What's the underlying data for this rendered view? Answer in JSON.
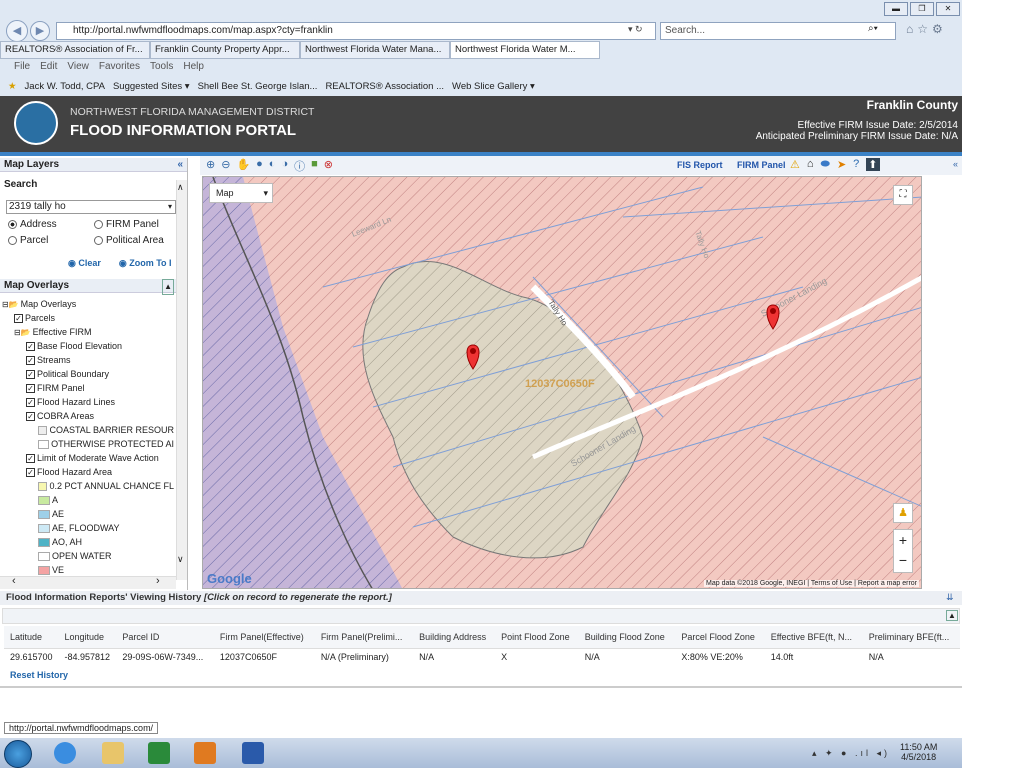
{
  "browser": {
    "url": "http://portal.nwfwmdfloodmaps.com/map.aspx?cty=franklin",
    "search_placeholder": "Search...",
    "tabs": [
      {
        "label": "REALTORS® Association of Fr...",
        "active": false
      },
      {
        "label": "Franklin County Property Appr...",
        "active": false
      },
      {
        "label": "Northwest Florida Water Mana...",
        "active": false
      },
      {
        "label": "Northwest Florida Water M...",
        "active": true
      }
    ],
    "menu": [
      "File",
      "Edit",
      "View",
      "Favorites",
      "Tools",
      "Help"
    ],
    "favorites": [
      "Jack W. Todd, CPA",
      "Suggested Sites ▾",
      "Shell Bee  St. George Islan...",
      "REALTORS® Association ...",
      "Web Slice Gallery ▾"
    ]
  },
  "header": {
    "org": "NORTHWEST FLORIDA MANAGEMENT DISTRICT",
    "title": "FLOOD INFORMATION PORTAL",
    "county": "Franklin County",
    "effective": "Effective FIRM Issue Date: 2/5/2014",
    "anticipated": "Anticipated Preliminary FIRM Issue Date: N/A"
  },
  "sidebar": {
    "map_layers": "Map Layers",
    "search": "Search",
    "search_value": "2319 tally ho",
    "radios": [
      {
        "label": "Address",
        "selected": true
      },
      {
        "label": "FIRM Panel",
        "selected": false
      },
      {
        "label": "Parcel",
        "selected": false
      },
      {
        "label": "Political Area",
        "selected": false
      }
    ],
    "clear": "Clear",
    "zoom": "Zoom To I",
    "map_overlays": "Map Overlays",
    "tree": [
      {
        "label": "Map Overlays",
        "indent": 0,
        "kind": "folder"
      },
      {
        "label": "Parcels",
        "indent": 1,
        "kind": "check"
      },
      {
        "label": "Effective FIRM",
        "indent": 1,
        "kind": "folder"
      },
      {
        "label": "Base Flood Elevation",
        "indent": 2,
        "kind": "check"
      },
      {
        "label": "Streams",
        "indent": 2,
        "kind": "check"
      },
      {
        "label": "Political Boundary",
        "indent": 2,
        "kind": "check"
      },
      {
        "label": "FIRM Panel",
        "indent": 2,
        "kind": "check"
      },
      {
        "label": "Flood Hazard Lines",
        "indent": 2,
        "kind": "check"
      },
      {
        "label": "COBRA Areas",
        "indent": 2,
        "kind": "check"
      },
      {
        "label": "COASTAL BARRIER RESOUR",
        "indent": 3,
        "kind": "legend"
      },
      {
        "label": "OTHERWISE PROTECTED AI",
        "indent": 3,
        "kind": "legend"
      },
      {
        "label": "Limit of Moderate Wave Action",
        "indent": 2,
        "kind": "check"
      },
      {
        "label": "Flood Hazard Area",
        "indent": 2,
        "kind": "check"
      },
      {
        "label": "0.2 PCT ANNUAL CHANCE FL",
        "indent": 3,
        "kind": "legend"
      },
      {
        "label": "A",
        "indent": 3,
        "kind": "legend"
      },
      {
        "label": "AE",
        "indent": 3,
        "kind": "legend"
      },
      {
        "label": "AE, FLOODWAY",
        "indent": 3,
        "kind": "legend"
      },
      {
        "label": "AO, AH",
        "indent": 3,
        "kind": "legend"
      },
      {
        "label": "OPEN WATER",
        "indent": 3,
        "kind": "legend"
      },
      {
        "label": "VE",
        "indent": 3,
        "kind": "legend"
      }
    ],
    "legend_colors": [
      "#eeeeee",
      "#ffffff",
      "#f7f7b0",
      "#c8eaa0",
      "#9ed0e8",
      "#cde9f5",
      "#4fb3c6",
      "#ffffff",
      "#f4a3a3"
    ]
  },
  "map": {
    "toolbar_fis": "FIS Report",
    "toolbar_firm": "FIRM Panel",
    "map_type": "Map",
    "panel_label": "12037C0650F",
    "streets": [
      "Tally Ho",
      "Schooner Landing",
      "Schooner Landing",
      "Tally Ho",
      "Leeward Ln"
    ],
    "google": "Google",
    "attribution": "Map data ©2018 Google, INEGI  |  Terms of Use  |  Report a map error"
  },
  "history": {
    "title": "Flood Information Reports' Viewing History",
    "hint": "[Click on record to regenerate the report.]",
    "columns": [
      "Latitude",
      "Longitude",
      "Parcel ID",
      "Firm Panel(Effective)",
      "Firm Panel(Prelimi...",
      "Building Address",
      "Point Flood Zone",
      "Building Flood Zone",
      "Parcel Flood Zone",
      "Effective BFE(ft, N...",
      "Preliminary BFE(ft..."
    ],
    "rows": [
      [
        "29.615700",
        "-84.957812",
        "29-09S-06W-7349...",
        "12037C0650F",
        "N/A (Preliminary)",
        "N/A",
        "X",
        "N/A",
        "X:80% VE:20%",
        "14.0ft",
        "N/A"
      ]
    ],
    "reset": "Reset History"
  },
  "status": {
    "tooltip": "http://portal.nwfwmdfloodmaps.com/",
    "time": "11:50 AM",
    "date": "4/5/2018"
  }
}
